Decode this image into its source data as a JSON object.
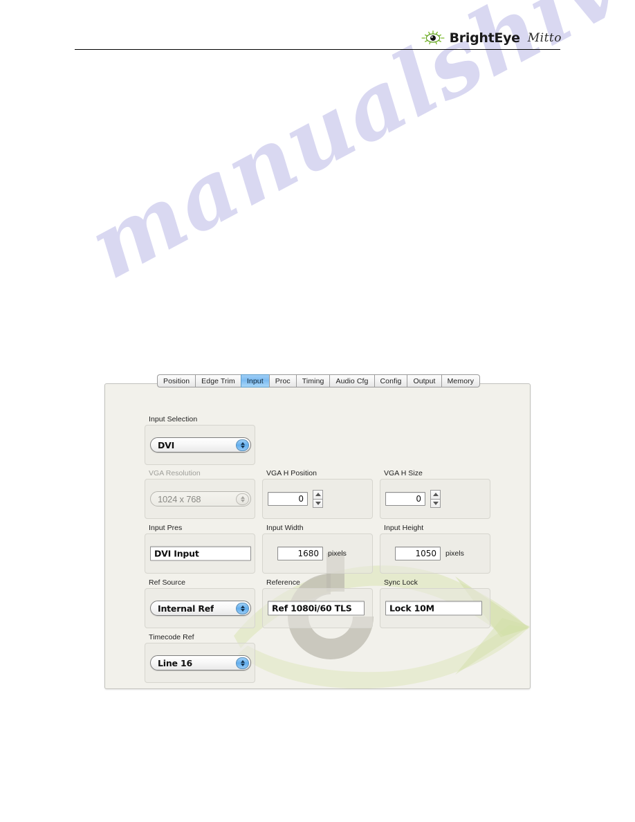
{
  "header": {
    "brand_name": "BrightEye",
    "brand_model": "Mitto",
    "eye_icon": "brighteye-eye-icon"
  },
  "watermark": {
    "text": "manualshive.com"
  },
  "tabs": [
    {
      "label": "Position",
      "selected": false
    },
    {
      "label": "Edge Trim",
      "selected": false
    },
    {
      "label": "Input",
      "selected": true
    },
    {
      "label": "Proc",
      "selected": false
    },
    {
      "label": "Timing",
      "selected": false
    },
    {
      "label": "Audio Cfg",
      "selected": false
    },
    {
      "label": "Config",
      "selected": false
    },
    {
      "label": "Output",
      "selected": false
    },
    {
      "label": "Memory",
      "selected": false
    }
  ],
  "form": {
    "input_selection": {
      "label": "Input Selection",
      "value": "DVI"
    },
    "vga_resolution": {
      "label": "VGA Resolution",
      "value": "1024 x 768",
      "state": "disabled"
    },
    "vga_h_position": {
      "label": "VGA H Position",
      "value": "0"
    },
    "vga_h_size": {
      "label": "VGA H Size",
      "value": "0"
    },
    "input_pres": {
      "label": "Input Pres",
      "value": "DVI Input"
    },
    "input_width": {
      "label": "Input Width",
      "value": "1680",
      "unit": "pixels"
    },
    "input_height": {
      "label": "Input Height",
      "value": "1050",
      "unit": "pixels"
    },
    "ref_source": {
      "label": "Ref Source",
      "value": "Internal Ref"
    },
    "reference": {
      "label": "Reference",
      "value": "Ref 1080i/60 TLS"
    },
    "sync_lock": {
      "label": "Sync Lock",
      "value": "Lock 10M"
    },
    "timecode_ref": {
      "label": "Timecode Ref",
      "value": "Line 16"
    }
  },
  "colors": {
    "tab_selected": "#7cbcf2",
    "stepper_blue": "#62aeee",
    "panel_bg": "#f2f1eb",
    "watermark_purple": "#c9c8ec",
    "eye_green": "#8cc63f"
  }
}
